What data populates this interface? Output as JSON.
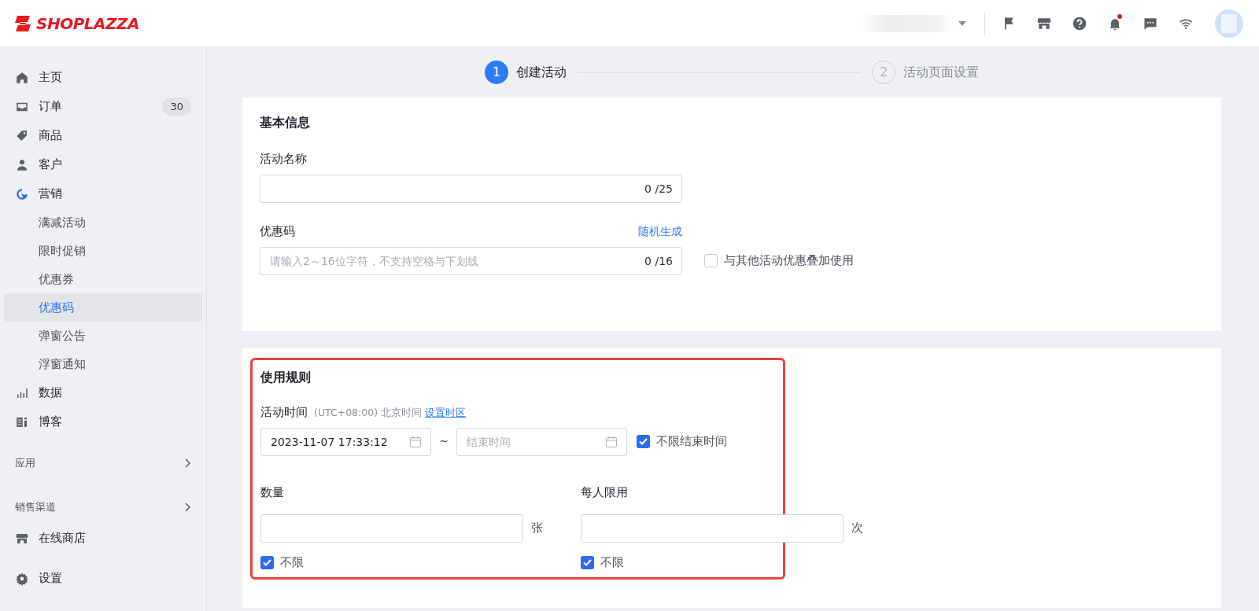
{
  "header": {
    "logo": "SHOPLAZZA",
    "notification_dot": true
  },
  "sidebar": {
    "items": [
      {
        "kind": "item",
        "label": "主页"
      },
      {
        "kind": "item",
        "label": "订单",
        "badge": "30"
      },
      {
        "kind": "item",
        "label": "商品"
      },
      {
        "kind": "item",
        "label": "客户"
      },
      {
        "kind": "item",
        "label": "营销",
        "expanded": true,
        "children": [
          {
            "label": "满减活动",
            "selected": false
          },
          {
            "label": "限时促销",
            "selected": false
          },
          {
            "label": "优惠券",
            "selected": false
          },
          {
            "label": "优惠码",
            "selected": true
          },
          {
            "label": "弹窗公告",
            "selected": false
          },
          {
            "label": "浮窗通知",
            "selected": false
          }
        ]
      },
      {
        "kind": "item",
        "label": "数据"
      },
      {
        "kind": "item",
        "label": "博客"
      },
      {
        "kind": "section",
        "label": "应用"
      },
      {
        "kind": "section",
        "label": "销售渠道"
      },
      {
        "kind": "item",
        "label": "在线商店"
      },
      {
        "kind": "item",
        "label": "设置"
      }
    ]
  },
  "steps": [
    {
      "number": "1",
      "label": "创建活动",
      "selected": true
    },
    {
      "number": "2",
      "label": "活动页面设置",
      "selected": false
    }
  ],
  "basic_info": {
    "title": "基本信息",
    "name_field": {
      "label": "活动名称",
      "counter": "0 /25"
    },
    "code_field": {
      "label": "优惠码",
      "link": "随机生成",
      "placeholder": "请输入2～16位字符，不支持空格与下划线",
      "counter": "0 /16",
      "checkbox": {
        "label": "与其他活动优惠叠加使用",
        "checked": false
      }
    }
  },
  "usage_rules": {
    "title": "使用规则",
    "highlighted": true,
    "time": {
      "label": "活动时间",
      "timezone": "(UTC+08:00) 北京时间",
      "link": "设置时区",
      "start_value": "2023-11-07 17:33:12",
      "separator": "~",
      "end_placeholder": "结束时间",
      "checkbox": {
        "label": "不限结束时间",
        "checked": true
      }
    },
    "limits": [
      {
        "label": "数量",
        "unit": "张",
        "checkbox": {
          "label": "不限",
          "checked": true
        }
      },
      {
        "label": "每人限用",
        "unit": "次",
        "checkbox": {
          "label": "不限",
          "checked": true
        }
      }
    ]
  }
}
